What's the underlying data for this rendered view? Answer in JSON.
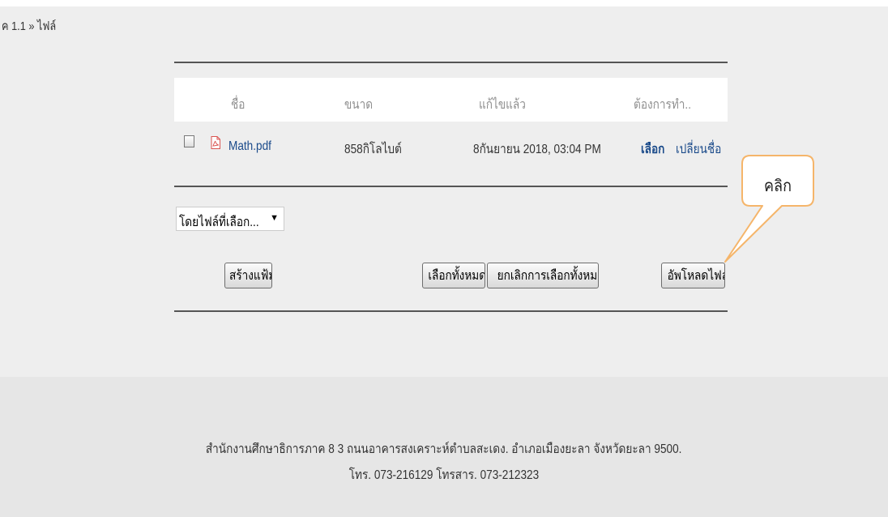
{
  "breadcrumb": "ค 1.1 » ไฟล์",
  "table": {
    "headers": [
      "ชื่อ",
      "ขนาด",
      "แก้ไขแล้ว",
      "ต้องการทำ.."
    ],
    "rows": [
      {
        "name": "Math.pdf",
        "size": "858กิโลไบต์",
        "modified": "8กันยายน 2018, 03:04 PM",
        "action_select": "เลือก",
        "action_rename": "เปลี่ยนชื่อ",
        "icon": "pdf-icon"
      }
    ]
  },
  "bulk_select": {
    "selected": "โดยไฟล์ที่เลือก..."
  },
  "buttons": {
    "create_folder": "สร้างแฟ้ม",
    "select_all": "เลือกทั้งหมด",
    "deselect_all": "ยกเลิกการเลือกทั้งหมด",
    "upload": "อัพโหลดไฟล์"
  },
  "callout": {
    "text": "คลิก",
    "border_color": "#f5b56a"
  },
  "footer": {
    "address": "สำนักงานศึกษาธิการภาค 8 3 ถนนอาคารสงเคราะห์ตำบลสะเดง. อำเภอเมืองยะลา จังหวัดยะลา 9500.",
    "phone": "โทร. 073-216129 โทรสาร. 073-212323"
  }
}
